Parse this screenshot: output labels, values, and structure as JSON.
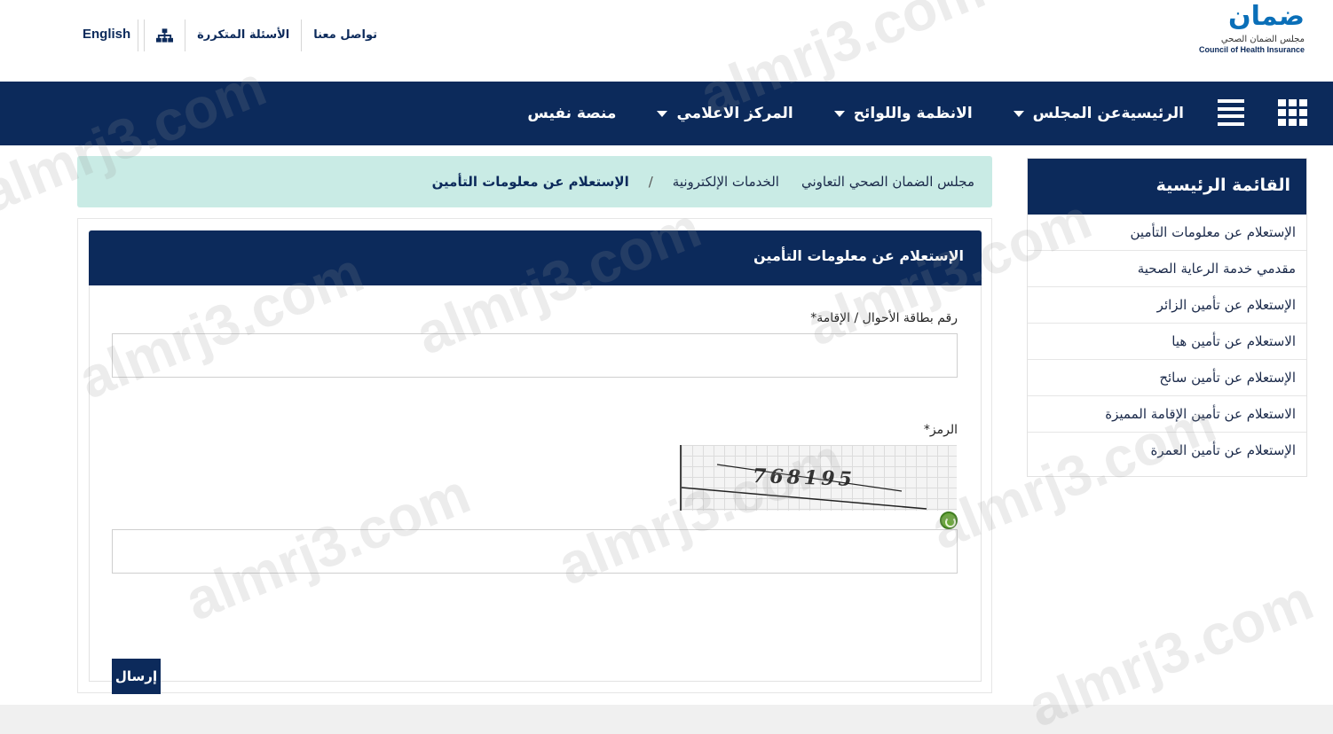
{
  "header": {
    "logo": {
      "mark": "ضمان",
      "arabic_name": "مجلس الضمان الصحي",
      "english_name": "Council of Health Insurance"
    },
    "links": [
      {
        "label": "تواصل معنا"
      },
      {
        "label": "الأسئلة المتكررة"
      }
    ],
    "sitemap_icon": "sitemap-icon",
    "language": "English"
  },
  "nav": {
    "items": [
      {
        "label": "الرئيسية",
        "dropdown": false
      },
      {
        "label": "عن المجلس",
        "dropdown": true
      },
      {
        "label": "الانظمة واللوائح",
        "dropdown": true
      },
      {
        "label": "المركز الاعلامي",
        "dropdown": true
      },
      {
        "label": "منصة نفيس",
        "dropdown": false
      }
    ]
  },
  "breadcrumb": {
    "items": [
      "مجلس الضمان الصحي التعاوني",
      "الخدمات الإلكترونية"
    ],
    "separator": "/",
    "current": "الإستعلام عن معلومات التأمين"
  },
  "sidebar": {
    "title": "القائمة الرئيسية",
    "items": [
      {
        "label": "الإستعلام عن معلومات التأمين"
      },
      {
        "label": "مقدمي خدمة الرعاية الصحية"
      },
      {
        "label": "الإستعلام عن تأمين الزائر"
      },
      {
        "label": "الاستعلام عن تأمين هيا"
      },
      {
        "label": "الإستعلام عن تأمين سائح"
      },
      {
        "label": "الاستعلام عن تأمين الإقامة المميزة"
      },
      {
        "label": "الإستعلام عن تأمين العمرة"
      }
    ]
  },
  "form": {
    "title": "الإستعلام عن معلومات التأمين",
    "id_label": "رقم بطاقة الأحوال / الإقامة*",
    "id_value": "",
    "captcha_label": "الرمز*",
    "captcha_text": "768195",
    "captcha_value": "",
    "submit_label": "إرسال"
  },
  "watermark": "almrj3.com",
  "colors": {
    "navy": "#0c2a5b",
    "breadcrumb_bg": "#c9ebe5",
    "logo_blue": "#0a6fb8"
  }
}
